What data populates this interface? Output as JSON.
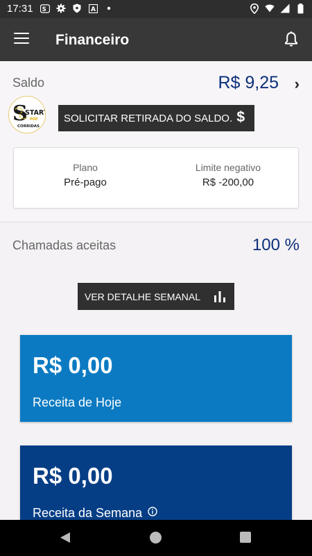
{
  "status_bar": {
    "time": "17:31",
    "left_icons": [
      "app-icon",
      "gear-icon",
      "shield-icon",
      "font-icon",
      "dot-icon"
    ],
    "right_icons": [
      "location-icon",
      "wifi-icon",
      "signal-icon",
      "battery-icon"
    ]
  },
  "header": {
    "title": "Financeiro"
  },
  "balance": {
    "label": "Saldo",
    "value": "R$ 9,25",
    "chevron": "›"
  },
  "logo": {
    "alt": "Start Pop Corridas",
    "line1": "START",
    "line2": "POP",
    "line3": "CORRIDAS"
  },
  "withdraw": {
    "label": "SOLICITAR RETIRADA DO SALDO.",
    "icon": "$"
  },
  "plan": {
    "plan_label": "Plano",
    "plan_value": "Pré-pago",
    "limit_label": "Limite negativo",
    "limit_value": "R$ -200,00"
  },
  "calls": {
    "label": "Chamadas aceitas",
    "value": "100 %"
  },
  "weekly": {
    "label": "VER DETALHE SEMANAL"
  },
  "revenue_today": {
    "amount": "R$ 0,00",
    "caption": "Receita de Hoje"
  },
  "revenue_week": {
    "amount": "R$ 0,00",
    "caption": "Receita da Semana"
  },
  "colors": {
    "accent_blue": "#0d2f7a",
    "today_card": "#0b7ac2",
    "week_card": "#063e86",
    "app_bar": "#383838"
  }
}
